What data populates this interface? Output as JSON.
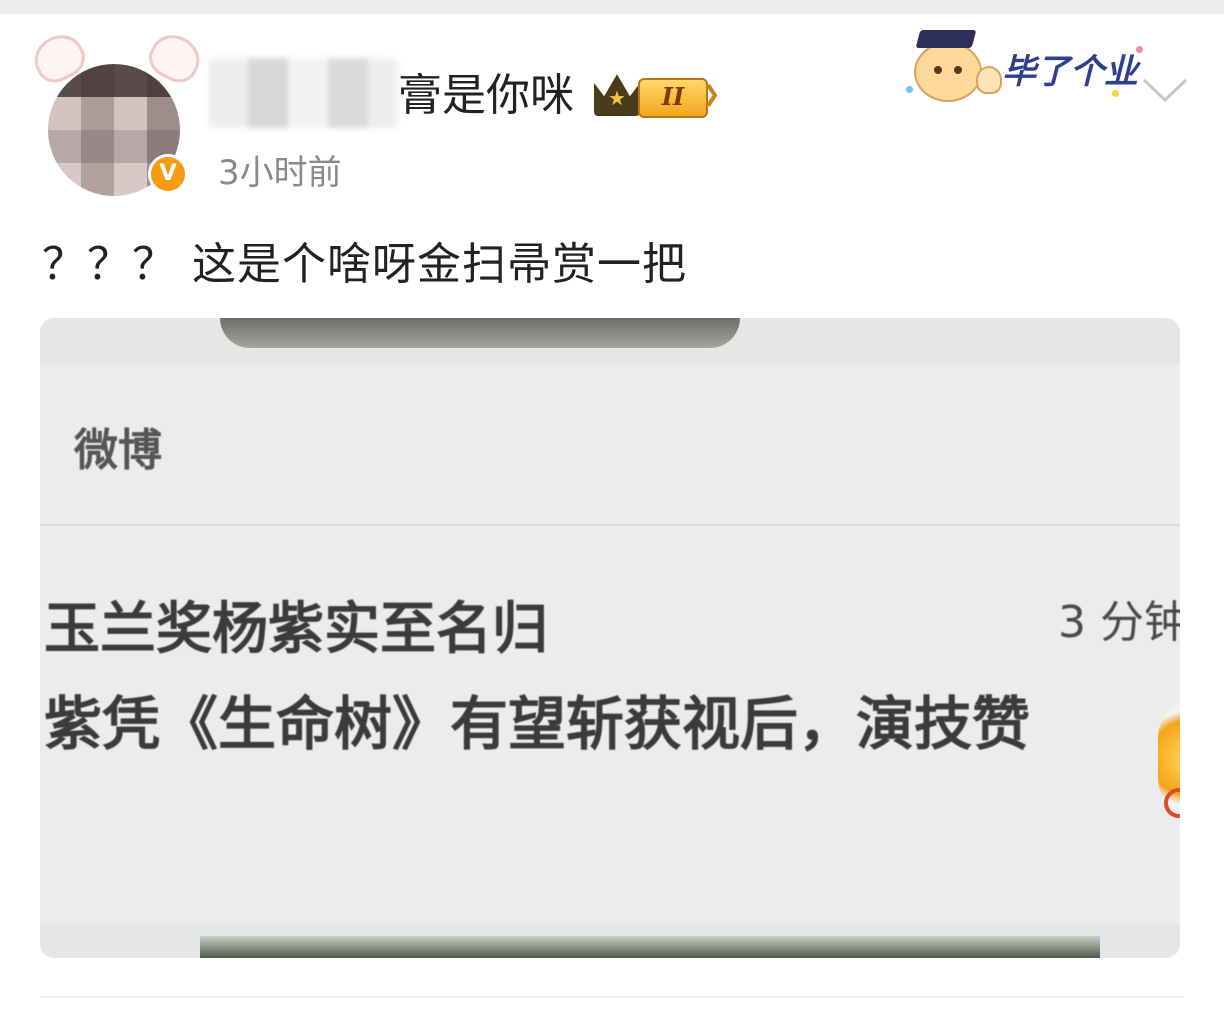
{
  "post": {
    "username_visible": "膏是你咪",
    "vip_level": "II",
    "timestamp": "3小时前",
    "verified_mark": "V",
    "text": "？？？ 这是个啥呀金扫帚赏一把",
    "card_decoration_text": "毕了个业"
  },
  "image": {
    "notification": {
      "app_name": "微博",
      "title": "玉兰奖杨紫实至名归",
      "time": "3 分钟",
      "body": "紫凭《生命树》有望斩获视后，演技赞"
    }
  },
  "colors": {
    "verified_badge": "#f59c12",
    "vip_gold": "#f4a51c",
    "decoration_text": "#2d3f8f",
    "timestamp": "#8a8a8a"
  },
  "icons": {
    "more": "chevron-down-icon",
    "vip": "crown-icon",
    "verified": "verified-v-icon"
  }
}
